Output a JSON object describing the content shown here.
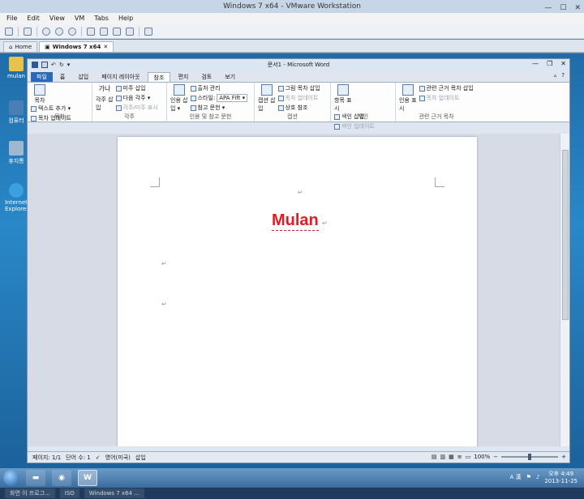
{
  "vm": {
    "title": "Windows 7 x64 - VMware Workstation",
    "menu": [
      "File",
      "Edit",
      "View",
      "VM",
      "Tabs",
      "Help"
    ],
    "tabs": [
      {
        "label": "Home",
        "active": false
      },
      {
        "label": "Windows 7 x64",
        "active": true
      }
    ]
  },
  "desktop": {
    "icons": [
      {
        "label": "mulan"
      },
      {
        "label": "컴퓨터"
      },
      {
        "label": "휴지통"
      },
      {
        "label": "Internet Explorer"
      }
    ]
  },
  "word": {
    "title": "문서1 - Microsoft Word",
    "ribbon_tabs": [
      "파일",
      "홈",
      "삽입",
      "페이지 레이아웃",
      "참조",
      "편지",
      "검토",
      "보기"
    ],
    "active_tab": "참조",
    "groups": {
      "toc": {
        "label": "목차",
        "big": "목차",
        "small": [
          "텍스트 추가 ▾",
          "목차 업데이트"
        ]
      },
      "footnotes": {
        "label": "각주",
        "big": "각주 삽입",
        "big_icon": "가나",
        "small": [
          "미주 삽입",
          "다음 각주 ▾",
          "각주/미주 표시"
        ]
      },
      "citations": {
        "label": "인용 및 참고 문헌",
        "big": "인용 삽입 ▾",
        "small": [
          "출처 관리",
          "스타일:",
          "참고 문헌 ▾"
        ],
        "style_value": "APA Fift ▾"
      },
      "captions": {
        "label": "캡션",
        "big": "캡션 삽입",
        "small": [
          "그림 목차 삽입",
          "목차 업데이트",
          "상호 참조"
        ]
      },
      "index": {
        "label": "색인",
        "big": "항목 표시",
        "small": [
          "색인 삽입",
          "색인 업데이트"
        ]
      },
      "authorities": {
        "label": "관련 근거 목차",
        "big": "인용 표시",
        "small": [
          "관련 근거 목차 삽입",
          "목차 업데이트"
        ]
      }
    },
    "document": {
      "title_text": "Mulan",
      "para_mark": "↵"
    },
    "status": {
      "page": "페이지: 1/1",
      "words": "단어 수: 1",
      "language": "영어(미국)",
      "mode": "삽입",
      "zoom": "100%"
    }
  },
  "taskbar": {
    "apps": [
      "folder",
      "media",
      "word"
    ],
    "time": "오후 4:49",
    "date": "2013-11-25",
    "ime": "A 漢"
  },
  "host_taskbar": {
    "items": [
      "화면 이 프로그...",
      "ISO",
      "Windows 7 x64 ..."
    ]
  }
}
